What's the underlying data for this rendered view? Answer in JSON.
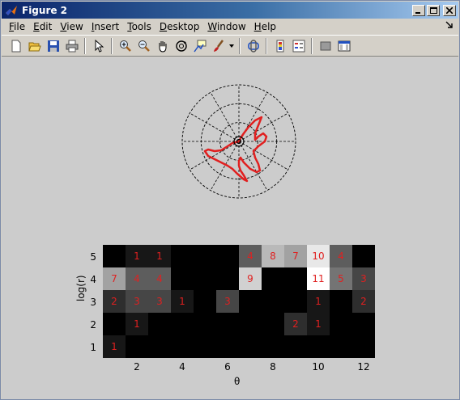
{
  "window": {
    "title": "Figure 2"
  },
  "menubar": {
    "items": [
      {
        "label": "File",
        "u": "F",
        "rest": "ile"
      },
      {
        "label": "Edit",
        "u": "E",
        "rest": "dit"
      },
      {
        "label": "View",
        "u": "V",
        "rest": "iew"
      },
      {
        "label": "Insert",
        "u": "I",
        "rest": "nsert"
      },
      {
        "label": "Tools",
        "u": "T",
        "rest": "ools"
      },
      {
        "label": "Desktop",
        "u": "D",
        "rest": "esktop"
      },
      {
        "label": "Window",
        "u": "W",
        "rest": "indow"
      },
      {
        "label": "Help",
        "u": "H",
        "rest": "elp"
      }
    ]
  },
  "toolbar": {
    "icons": [
      "new-figure-icon",
      "open-file-icon",
      "save-icon",
      "print-icon",
      "pointer-icon",
      "zoom-in-icon",
      "zoom-out-icon",
      "pan-icon",
      "rotate-3d-icon",
      "data-cursor-icon",
      "brush-icon",
      "link-plot-icon",
      "colorbar-icon",
      "legend-icon",
      "hide-plot-tools-icon",
      "show-plot-tools-icon"
    ]
  },
  "colors": {
    "accent_red": "#e02020",
    "title_blue": "#0a246a"
  },
  "chart_data": [
    {
      "type": "scatter",
      "coordinate_system": "polar",
      "rings": 3,
      "spokes": 12
    },
    {
      "type": "heatmap",
      "xlabel": "θ",
      "ylabel": "log(r)",
      "x_ticks": [
        "2",
        "4",
        "6",
        "8",
        "10",
        "12"
      ],
      "y_ticks": [
        "1",
        "2",
        "3",
        "4",
        "5"
      ],
      "cols": 12,
      "rows_top_to_bottom": [
        5,
        4,
        3,
        2,
        1
      ],
      "values": [
        [
          0,
          1,
          1,
          0,
          0,
          0,
          4,
          8,
          7,
          10,
          4,
          0
        ],
        [
          7,
          4,
          4,
          0,
          0,
          0,
          9,
          0,
          0,
          11,
          5,
          3
        ],
        [
          2,
          3,
          3,
          1,
          0,
          3,
          0,
          0,
          0,
          1,
          0,
          2
        ],
        [
          0,
          1,
          0,
          0,
          0,
          0,
          0,
          0,
          2,
          1,
          0,
          0
        ],
        [
          1,
          0,
          0,
          0,
          0,
          0,
          0,
          0,
          0,
          0,
          0,
          0
        ]
      ],
      "vmax": 11
    }
  ]
}
